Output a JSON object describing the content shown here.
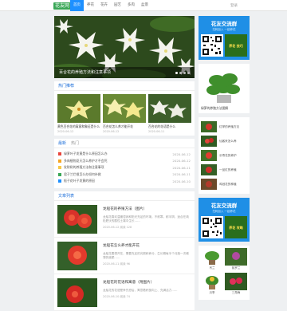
{
  "header": {
    "logo": "花友网",
    "nav": [
      "首页",
      "养花",
      "花卉",
      "园艺",
      "多肉",
      "盆景"
    ],
    "right_link": "登录"
  },
  "hero": {
    "caption": "百合花的养殖方法和注意事项",
    "slides": 4
  },
  "featured": {
    "title": "热门推荐",
    "items": [
      {
        "title": "黄色百合花的寓意和象征是什么",
        "meta": "2020-06-12"
      },
      {
        "title": "百合花怎么养才能开花",
        "meta": "2020-06-12"
      },
      {
        "title": "百合花的花语是什么",
        "meta": "2020-06-11"
      }
    ]
  },
  "news": {
    "tabs": [
      "最新",
      "热门"
    ],
    "items": [
      {
        "title": "绿萝叶子发黄是什么原因怎么办",
        "date": "2020-06-12",
        "color": "#e8453c"
      },
      {
        "title": "多肉植物夏天怎么养护才不会死",
        "date": "2020-06-12",
        "color": "#f5a623"
      },
      {
        "title": "发财树的养殖方法和注意事项",
        "date": "2020-06-11",
        "color": "#f7c948"
      },
      {
        "title": "君子兰烂根怎么办如何补救",
        "date": "2020-06-11",
        "color": "#3aa757"
      },
      {
        "title": "栀子花叶子发黄的原因",
        "date": "2020-06-10",
        "color": "#1e90ff"
      }
    ]
  },
  "articles": {
    "title": "文章列表",
    "items": [
      {
        "title": "龙船花的养殖方法（图片）",
        "desc": "龙船花喜欢温暖湿润和阳光充足的环境，不耐寒，耐半阴，适合在疏松肥沃的酸性土壤中生长……",
        "meta": "2020-06-12  阅读 128"
      },
      {
        "title": "龙船花怎么养才能开花",
        "desc": "龙船花要想开花，需要充足的光照和养分，生长期每半个月施一次稀薄的液肥……",
        "meta": "2020-06-11  阅读 96"
      },
      {
        "title": "龙船花的花语和寓意（附图片）",
        "desc": "龙船花的花语是争先恐后，寓意着积极向上、充满活力……",
        "meta": "2020-06-10  阅读 74"
      }
    ]
  },
  "sidebar": {
    "qr1": {
      "title": "花友交流群",
      "sub": "扫码加入 一起养花",
      "promo": "养花 技巧"
    },
    "feature": {
      "title": "绿萝的养殖方法图解"
    },
    "list": [
      {
        "text": "红掌的养殖方法"
      },
      {
        "text": "仙客来怎么养"
      },
      {
        "text": "长寿花的养护"
      },
      {
        "text": "一品红的养殖"
      },
      {
        "text": "鸡冠花的种植"
      }
    ],
    "qr2": {
      "title": "花友交流群",
      "sub": "扫码加入 一起养花",
      "promo": "养花 攻略"
    },
    "grid": [
      {
        "caption": "吊兰"
      },
      {
        "caption": "紫罗兰"
      },
      {
        "caption": "月季"
      },
      {
        "caption": "三角梅"
      }
    ]
  }
}
